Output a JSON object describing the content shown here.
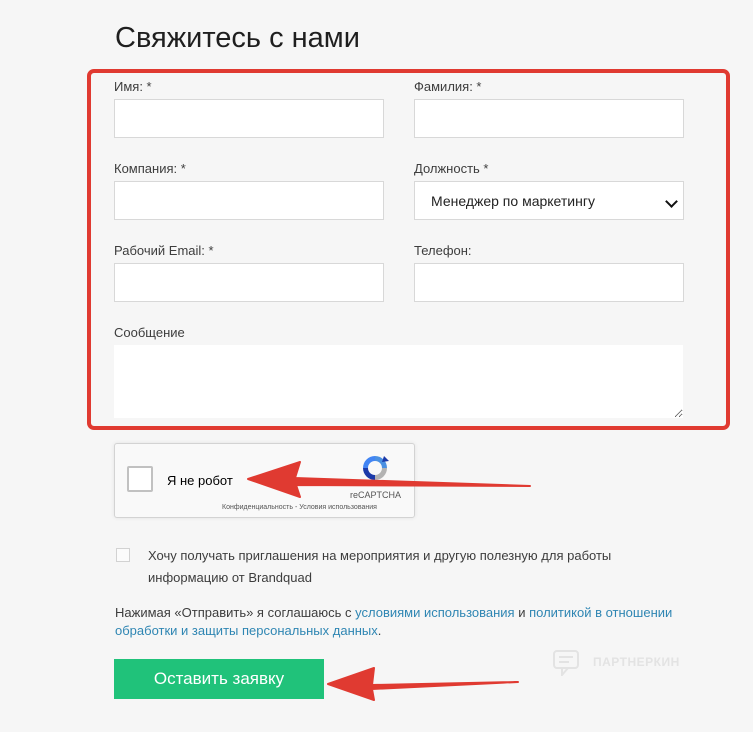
{
  "form": {
    "title": "Свяжитесь с нами",
    "fields": {
      "first_name": {
        "label": "Имя: *",
        "value": ""
      },
      "last_name": {
        "label": "Фамилия: *",
        "value": ""
      },
      "company": {
        "label": "Компания: *",
        "value": ""
      },
      "position": {
        "label": "Должность *",
        "value": "Менеджер по маркетингу"
      },
      "email": {
        "label": "Рабочий Email: *",
        "value": ""
      },
      "phone": {
        "label": "Телефон:",
        "value": ""
      },
      "message": {
        "label": "Сообщение",
        "value": ""
      }
    },
    "captcha": {
      "label": "Я не робот",
      "brand": "reCAPTCHA",
      "links": "Конфиденциальность - Условия использования"
    },
    "consent": {
      "text": "Хочу получать приглашения на мероприятия и другую полезную для работы информацию от Brandquad",
      "checked": false
    },
    "agreement": {
      "prefix": "Нажимая «Отправить» я соглашаюсь с ",
      "terms_link": "условиями использования",
      "middle": " и ",
      "privacy_link": "политикой в отношении обработки и защиты персональных данных",
      "suffix": "."
    },
    "submit_label": "Оставить заявку"
  },
  "watermark": {
    "text": "ПАРТНЕРКИН"
  },
  "colors": {
    "highlight": "#e03a31",
    "arrow": "#e03a31",
    "submit": "#20c27a",
    "link": "#2f86b3"
  }
}
